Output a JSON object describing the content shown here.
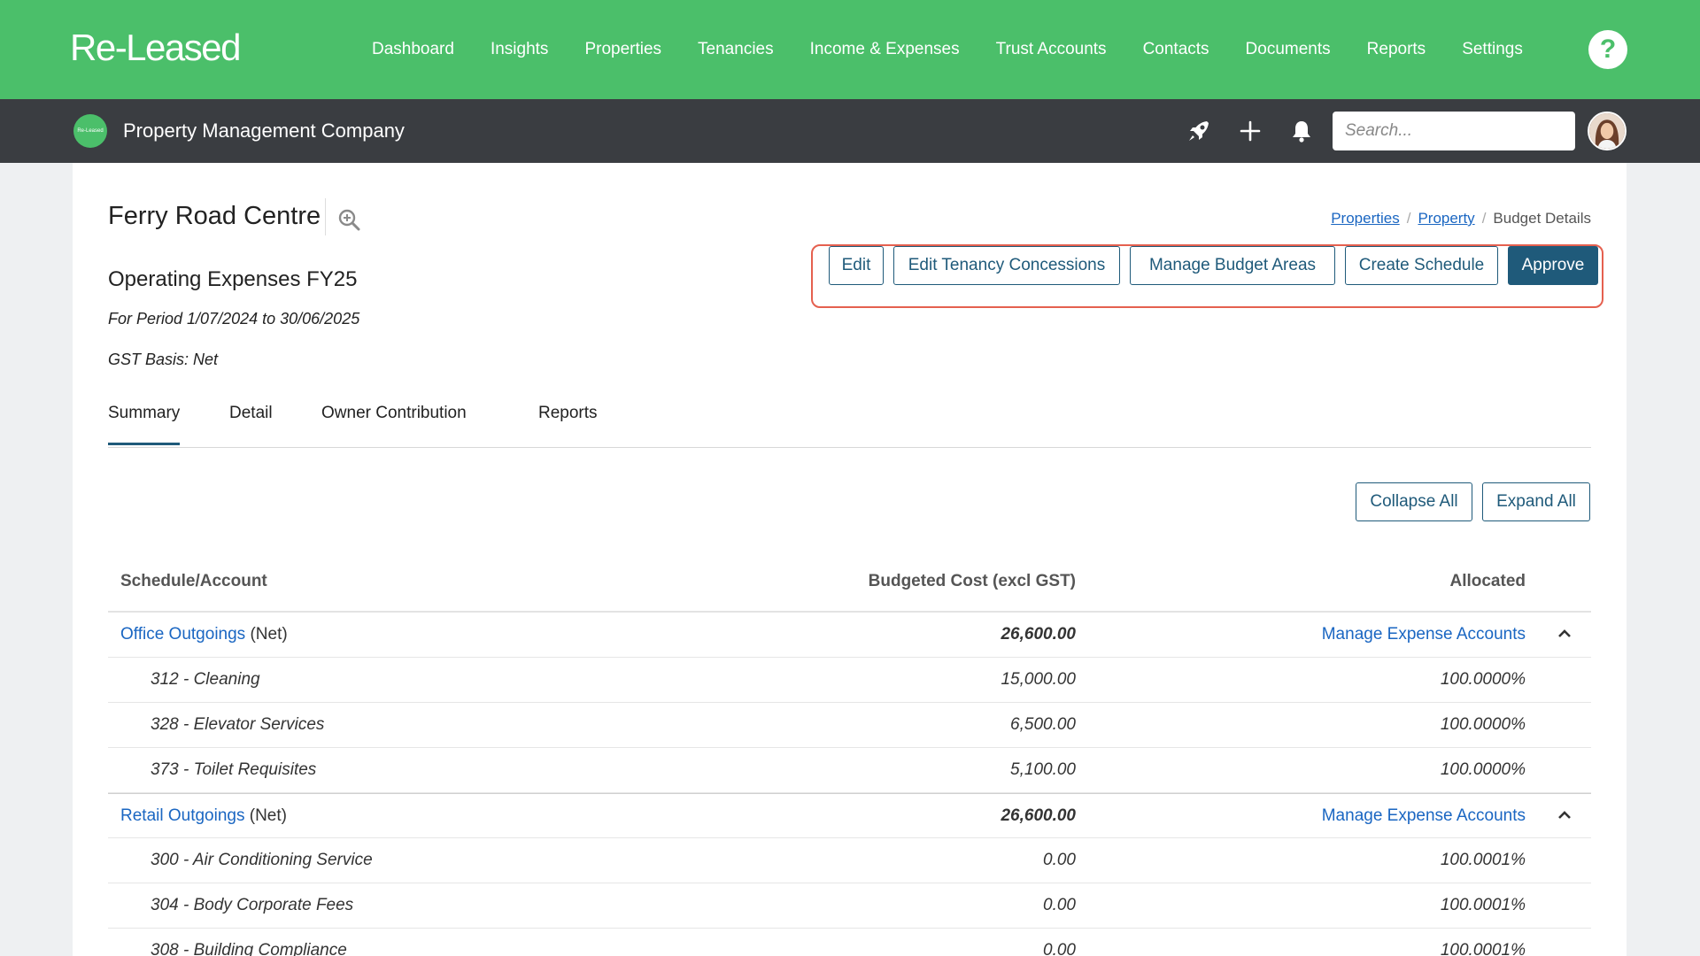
{
  "topnav": {
    "logo": "Re-Leased",
    "links": [
      "Dashboard",
      "Insights",
      "Properties",
      "Tenancies",
      "Income & Expenses",
      "Trust Accounts",
      "Contacts",
      "Documents",
      "Reports",
      "Settings"
    ],
    "help": "?"
  },
  "subheader": {
    "org_logo_text": "Re-Leased",
    "org_name": "Property Management Company",
    "search_placeholder": "Search..."
  },
  "page": {
    "title": "Ferry Road Centre",
    "breadcrumb": [
      "Properties",
      "Property",
      "Budget Details"
    ],
    "budget_name": "Operating Expenses FY25",
    "period": "For Period 1/07/2024 to 30/06/2025",
    "gst_basis": "GST Basis: Net"
  },
  "actions": [
    "Edit",
    "Edit Tenancy Concessions",
    "Manage Budget Areas",
    "Create Schedule",
    "Approve"
  ],
  "tabs": [
    "Summary",
    "Detail",
    "Owner Contribution",
    "Reports"
  ],
  "active_tab": "Summary",
  "table_controls": {
    "collapse": "Collapse All",
    "expand": "Expand All"
  },
  "table": {
    "headers": [
      "Schedule/Account",
      "Budgeted Cost (excl GST)",
      "Allocated"
    ],
    "groups": [
      {
        "name": "Office Outgoings",
        "basis": "(Net)",
        "total": "26,600.00",
        "manage_label": "Manage Expense Accounts",
        "rows": [
          {
            "account": "312 - Cleaning",
            "budget": "15,000.00",
            "allocated": "100.0000%"
          },
          {
            "account": "328 - Elevator Services",
            "budget": "6,500.00",
            "allocated": "100.0000%"
          },
          {
            "account": "373 - Toilet Requisites",
            "budget": "5,100.00",
            "allocated": "100.0000%"
          }
        ]
      },
      {
        "name": "Retail Outgoings",
        "basis": "(Net)",
        "total": "26,600.00",
        "manage_label": "Manage Expense Accounts",
        "rows": [
          {
            "account": "300 - Air Conditioning Service",
            "budget": "0.00",
            "allocated": "100.0001%"
          },
          {
            "account": "304 - Body Corporate Fees",
            "budget": "0.00",
            "allocated": "100.0001%"
          },
          {
            "account": "308 - Building Compliance",
            "budget": "0.00",
            "allocated": "100.0001%"
          }
        ]
      }
    ]
  },
  "colors": {
    "brand_green": "#4bbf6a",
    "subheader": "#3a3d41",
    "primary": "#1f5a7a",
    "link": "#1a66c2",
    "highlight": "#e5604f"
  }
}
